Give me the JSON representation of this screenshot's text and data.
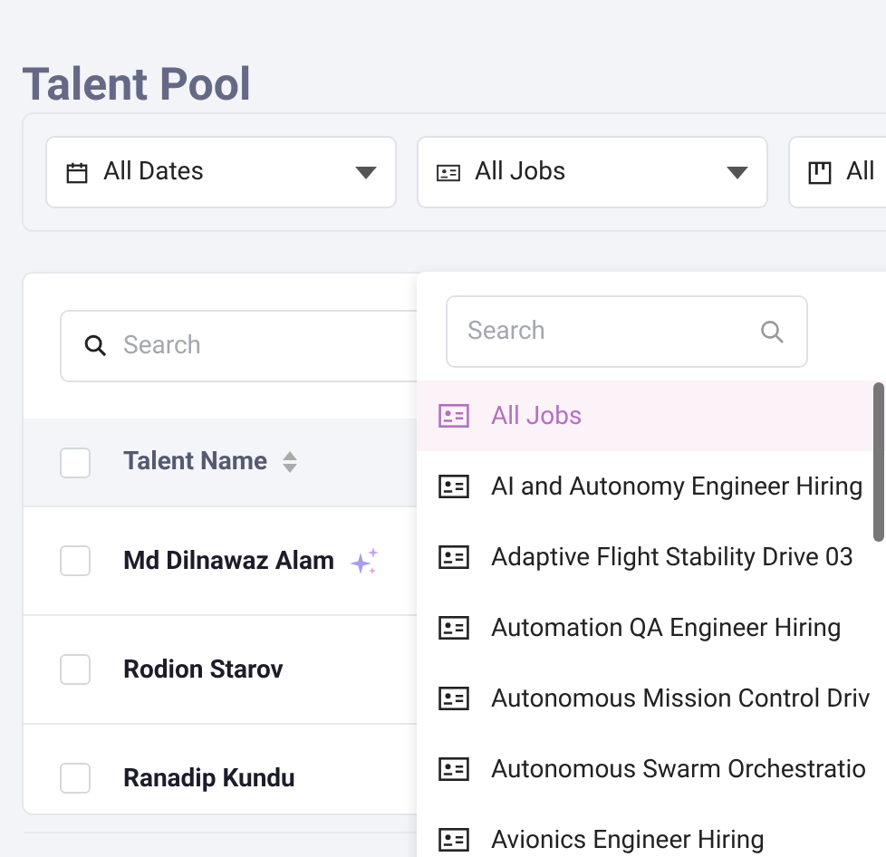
{
  "page": {
    "title": "Talent Pool"
  },
  "filters": [
    {
      "kind": "date",
      "label": "All Dates"
    },
    {
      "kind": "job",
      "label": "All Jobs"
    },
    {
      "kind": "stage",
      "label": "All"
    }
  ],
  "table": {
    "search": {
      "placeholder": "Search"
    },
    "select_all_checked": false,
    "columns": [
      {
        "label": "Talent Name"
      }
    ],
    "rows": [
      {
        "name": "Md Dilnawaz Alam",
        "checked": false,
        "ai_match": true
      },
      {
        "name": "Rodion Starov",
        "checked": false,
        "ai_match": false
      },
      {
        "name": "Ranadip Kundu",
        "checked": false,
        "ai_match": false
      }
    ]
  },
  "job_dropdown": {
    "search": {
      "placeholder": "Search"
    },
    "items": [
      {
        "label": "All Jobs",
        "selected": true
      },
      {
        "label": "AI and Autonomy Engineer Hiring",
        "selected": false
      },
      {
        "label": "Adaptive Flight Stability Drive 03",
        "selected": false
      },
      {
        "label": "Automation QA Engineer Hiring",
        "selected": false
      },
      {
        "label": "Autonomous Mission Control Driv",
        "selected": false
      },
      {
        "label": "Autonomous Swarm Orchestratio",
        "selected": false
      },
      {
        "label": "Avionics Engineer Hiring",
        "selected": false
      }
    ]
  }
}
